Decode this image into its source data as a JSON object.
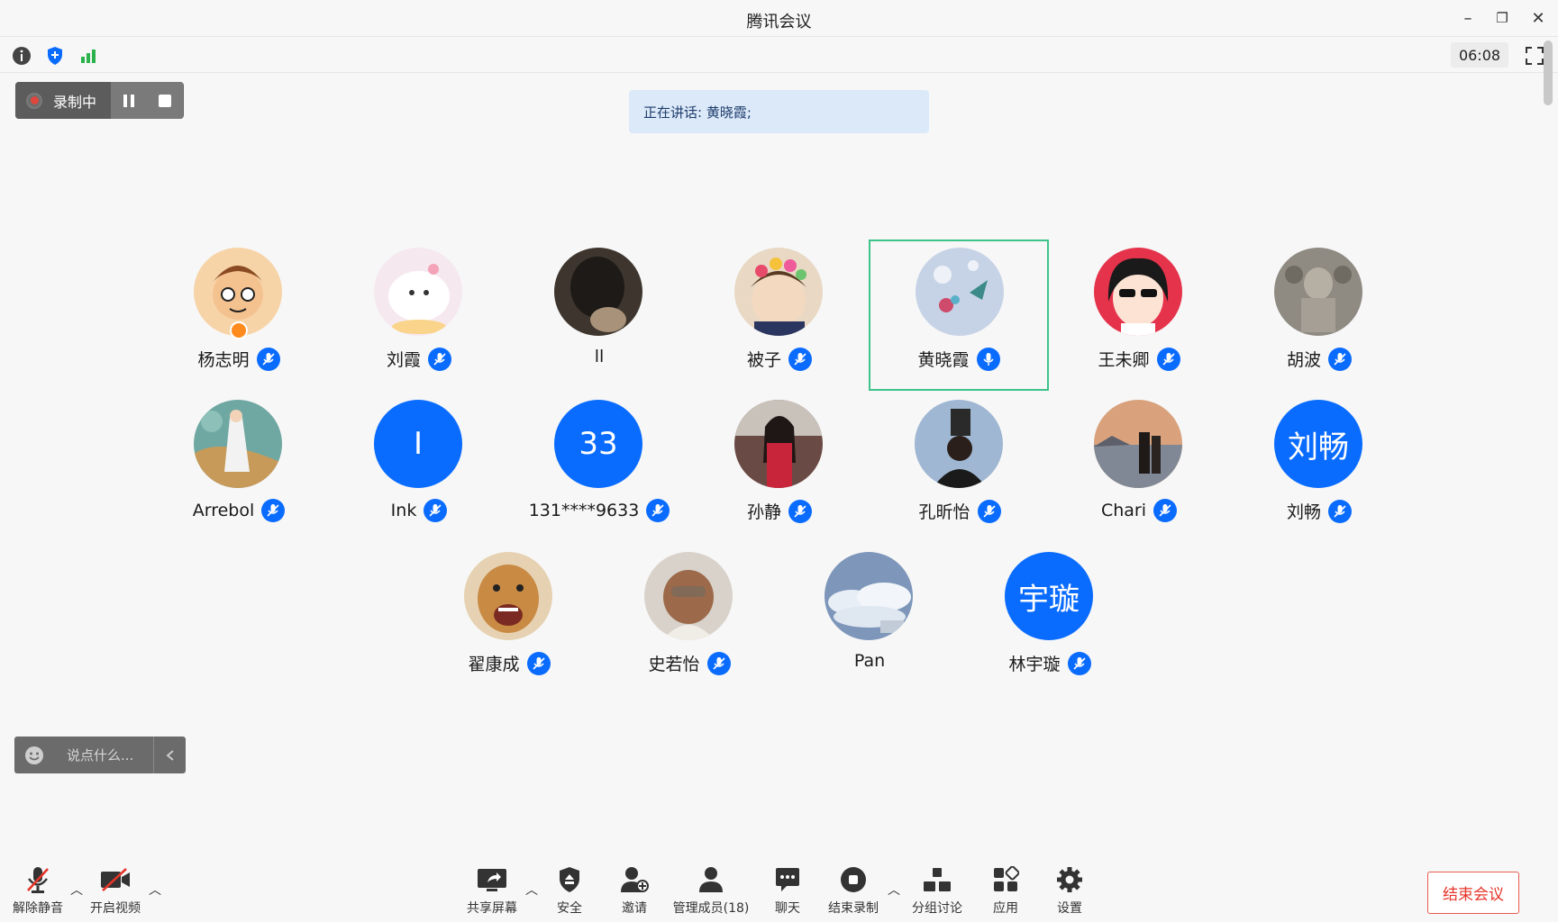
{
  "window": {
    "title": "腾讯会议",
    "minimize": "–",
    "restore": "❐",
    "close": "✕"
  },
  "statusbar": {
    "timer": "06:08"
  },
  "recording": {
    "label": "录制中"
  },
  "speaking": {
    "text": "正在讲话: 黄晓霞;"
  },
  "participants": [
    {
      "name": "杨志明",
      "avatar_text": "",
      "color": "#f2c99a"
    },
    {
      "name": "刘霞",
      "avatar_text": "",
      "color": "#f4e4ec"
    },
    {
      "name": "ll",
      "avatar_text": "",
      "color": "#4a4036"
    },
    {
      "name": "被子",
      "avatar_text": "",
      "color": "#d8c0a8"
    },
    {
      "name": "黄晓霞",
      "avatar_text": "",
      "color": "#b9cbe6"
    },
    {
      "name": "王未卿",
      "avatar_text": "",
      "color": "#e5334b"
    },
    {
      "name": "胡波",
      "avatar_text": "",
      "color": "#8a857c"
    },
    {
      "name": "Arrebol",
      "avatar_text": "",
      "color": "#5f9e9a"
    },
    {
      "name": "Ink",
      "avatar_text": "I",
      "color": "#0a6cff"
    },
    {
      "name": "131****9633",
      "avatar_text": "33",
      "color": "#0a6cff"
    },
    {
      "name": "孙静",
      "avatar_text": "",
      "color": "#7a4a46"
    },
    {
      "name": "孔昕怡",
      "avatar_text": "",
      "color": "#8ea9c8"
    },
    {
      "name": "Chari",
      "avatar_text": "",
      "color": "#c89478"
    },
    {
      "name": "刘畅",
      "avatar_text": "刘畅",
      "color": "#0a6cff"
    },
    {
      "name": "翟康成",
      "avatar_text": "",
      "color": "#c48a4c"
    },
    {
      "name": "史若怡",
      "avatar_text": "",
      "color": "#d6cfc6"
    },
    {
      "name": "Pan",
      "avatar_text": "",
      "color": "#8aa4c4"
    },
    {
      "name": "林宇璇",
      "avatar_text": "宇璇",
      "color": "#0a6cff"
    }
  ],
  "chat": {
    "placeholder": "说点什么..."
  },
  "toolbar": {
    "unmute": "解除静音",
    "start_video": "开启视频",
    "share_screen": "共享屏幕",
    "security": "安全",
    "invite": "邀请",
    "manage_members": "管理成员(18)",
    "chat": "聊天",
    "end_recording": "结束录制",
    "breakout": "分组讨论",
    "apps": "应用",
    "settings": "设置",
    "end_meeting": "结束会议"
  },
  "colors": {
    "accent_blue": "#0a6cff",
    "active_border": "#3ec38a",
    "end_red": "#e5352a",
    "signal_green": "#2bb24c"
  }
}
